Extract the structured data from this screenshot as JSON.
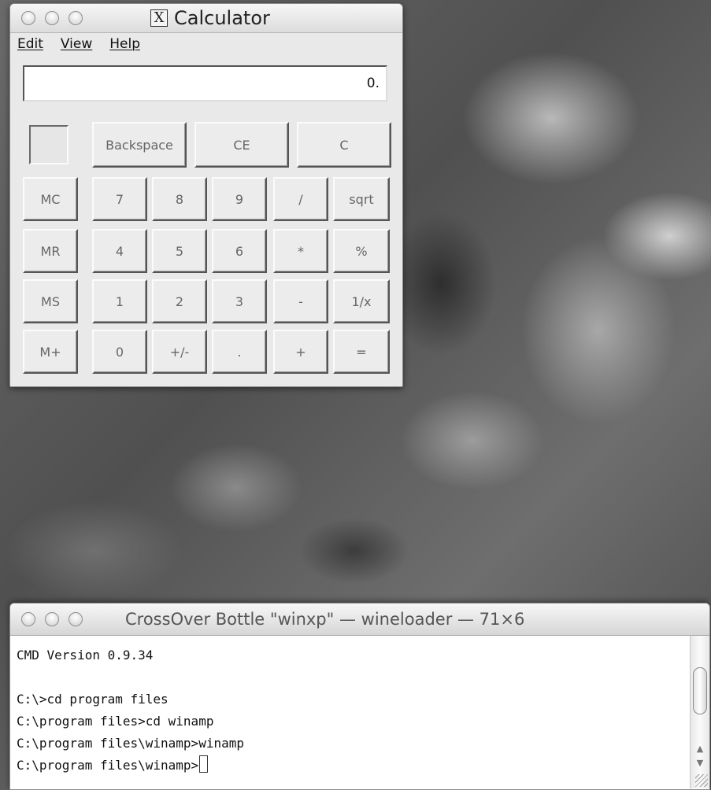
{
  "calculator": {
    "title": "Calculator",
    "title_icon": "X",
    "menu": [
      "Edit",
      "View",
      "Help"
    ],
    "display_value": "0.",
    "top_buttons": [
      "Backspace",
      "CE",
      "C"
    ],
    "memory_buttons": [
      "MC",
      "MR",
      "MS",
      "M+"
    ],
    "keypad": [
      [
        "7",
        "8",
        "9",
        "/",
        "sqrt"
      ],
      [
        "4",
        "5",
        "6",
        "*",
        "%"
      ],
      [
        "1",
        "2",
        "3",
        "-",
        "1/x"
      ],
      [
        "0",
        "+/-",
        ".",
        "+",
        "="
      ]
    ]
  },
  "terminal": {
    "title": "CrossOver Bottle \"winxp\" — wineloader — 71×6",
    "lines": [
      "CMD Version 0.9.34",
      "",
      "C:\\>cd program files",
      "C:\\program files>cd winamp",
      "C:\\program files\\winamp>winamp",
      "C:\\program files\\winamp>"
    ]
  }
}
